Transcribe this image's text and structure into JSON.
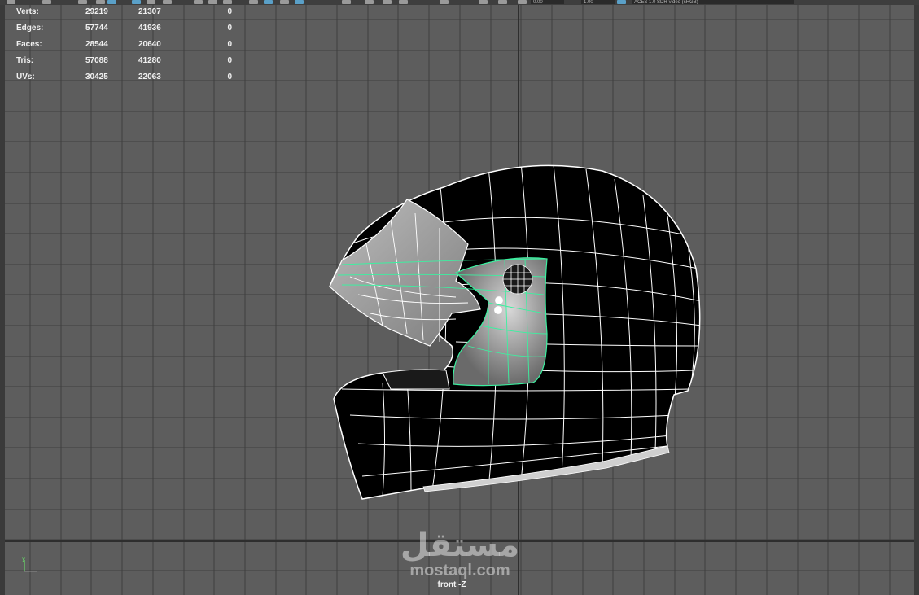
{
  "toolbar": {
    "field1": "0.00",
    "field2": "1.00",
    "colorspace": "ACES 1.0 SDR-video (sRGB)"
  },
  "stats": [
    {
      "label": "Verts:",
      "total": "29219",
      "selected": "21307",
      "extra": "0"
    },
    {
      "label": "Edges:",
      "total": "57744",
      "selected": "41936",
      "extra": "0"
    },
    {
      "label": "Faces:",
      "total": "28544",
      "selected": "20640",
      "extra": "0"
    },
    {
      "label": "Tris:",
      "total": "57088",
      "selected": "41280",
      "extra": "0"
    },
    {
      "label": "UVs:",
      "total": "30425",
      "selected": "22063",
      "extra": "0"
    }
  ],
  "viewport": {
    "camera_label": "front -Z",
    "axis_label": "y"
  },
  "watermark": {
    "logo_text": "مستقل",
    "site": "mostaql.com"
  },
  "colors": {
    "grid_line": "#3d3d3d",
    "axis_line": "#2f2f2f",
    "wire": "#ffffff",
    "selection": "#3cf0a0",
    "helmet_shell": "#000000"
  }
}
